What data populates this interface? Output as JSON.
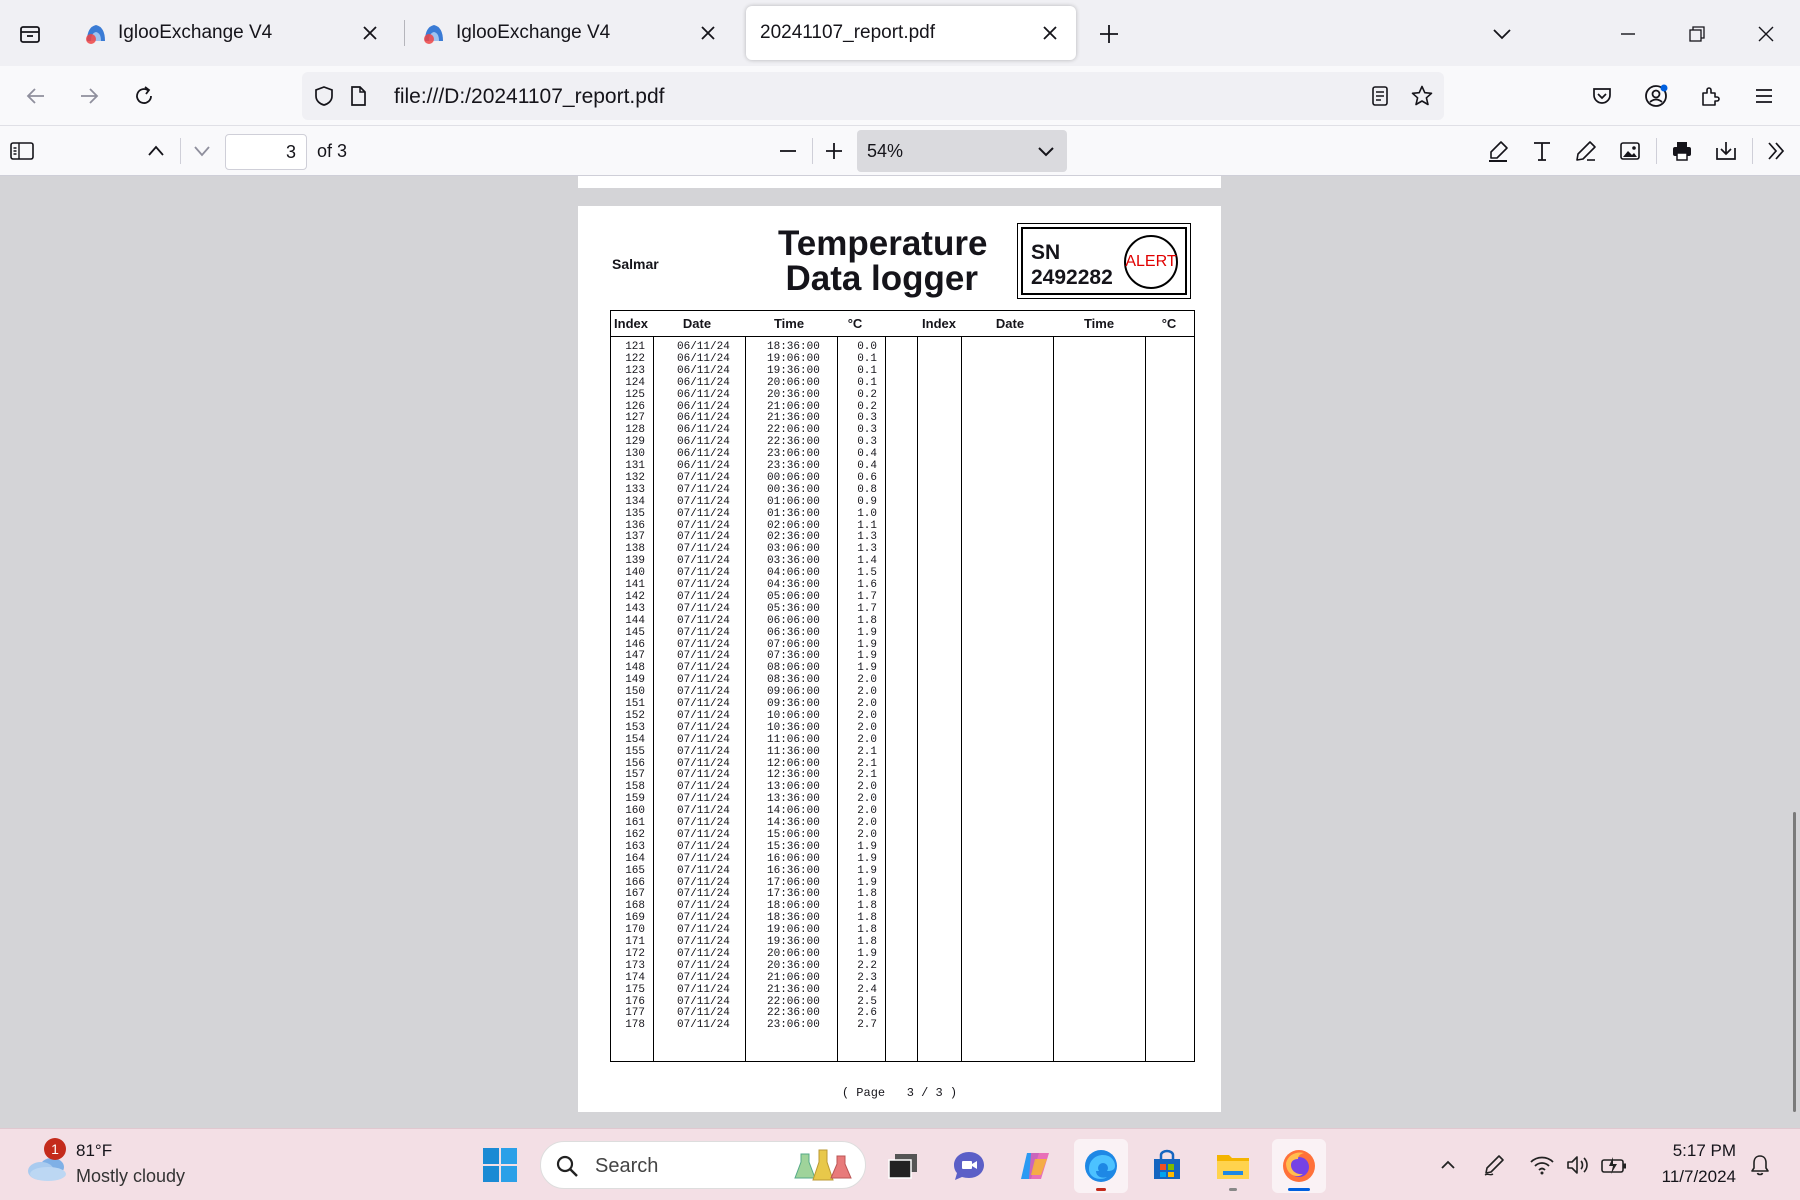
{
  "tabs": [
    {
      "title": "IglooExchange V4",
      "active": false
    },
    {
      "title": "IglooExchange V4",
      "active": false
    },
    {
      "title": "20241107_report.pdf",
      "active": true
    }
  ],
  "urlbar": {
    "url": "file:///D:/20241107_report.pdf"
  },
  "pdf_toolbar": {
    "page_number": "3",
    "page_total": "of 3",
    "zoom": "54%"
  },
  "document": {
    "company": "Salmar",
    "title_line1": "Temperature",
    "title_line2": "Data logger",
    "sn_label": "SN",
    "sn_number": "2492282",
    "alert": "ALERT",
    "columns": [
      "Index",
      "Date",
      "Time",
      "°C",
      "Index",
      "Date",
      "Time",
      "°C"
    ],
    "footer": "( Page   3 / 3 )",
    "rows": [
      [
        "121",
        "06/11/24",
        "18:36:00",
        "0.0"
      ],
      [
        "122",
        "06/11/24",
        "19:06:00",
        "0.1"
      ],
      [
        "123",
        "06/11/24",
        "19:36:00",
        "0.1"
      ],
      [
        "124",
        "06/11/24",
        "20:06:00",
        "0.1"
      ],
      [
        "125",
        "06/11/24",
        "20:36:00",
        "0.2"
      ],
      [
        "126",
        "06/11/24",
        "21:06:00",
        "0.2"
      ],
      [
        "127",
        "06/11/24",
        "21:36:00",
        "0.3"
      ],
      [
        "128",
        "06/11/24",
        "22:06:00",
        "0.3"
      ],
      [
        "129",
        "06/11/24",
        "22:36:00",
        "0.3"
      ],
      [
        "130",
        "06/11/24",
        "23:06:00",
        "0.4"
      ],
      [
        "131",
        "06/11/24",
        "23:36:00",
        "0.4"
      ],
      [
        "132",
        "07/11/24",
        "00:06:00",
        "0.6"
      ],
      [
        "133",
        "07/11/24",
        "00:36:00",
        "0.8"
      ],
      [
        "134",
        "07/11/24",
        "01:06:00",
        "0.9"
      ],
      [
        "135",
        "07/11/24",
        "01:36:00",
        "1.0"
      ],
      [
        "136",
        "07/11/24",
        "02:06:00",
        "1.1"
      ],
      [
        "137",
        "07/11/24",
        "02:36:00",
        "1.3"
      ],
      [
        "138",
        "07/11/24",
        "03:06:00",
        "1.3"
      ],
      [
        "139",
        "07/11/24",
        "03:36:00",
        "1.4"
      ],
      [
        "140",
        "07/11/24",
        "04:06:00",
        "1.5"
      ],
      [
        "141",
        "07/11/24",
        "04:36:00",
        "1.6"
      ],
      [
        "142",
        "07/11/24",
        "05:06:00",
        "1.7"
      ],
      [
        "143",
        "07/11/24",
        "05:36:00",
        "1.7"
      ],
      [
        "144",
        "07/11/24",
        "06:06:00",
        "1.8"
      ],
      [
        "145",
        "07/11/24",
        "06:36:00",
        "1.9"
      ],
      [
        "146",
        "07/11/24",
        "07:06:00",
        "1.9"
      ],
      [
        "147",
        "07/11/24",
        "07:36:00",
        "1.9"
      ],
      [
        "148",
        "07/11/24",
        "08:06:00",
        "1.9"
      ],
      [
        "149",
        "07/11/24",
        "08:36:00",
        "2.0"
      ],
      [
        "150",
        "07/11/24",
        "09:06:00",
        "2.0"
      ],
      [
        "151",
        "07/11/24",
        "09:36:00",
        "2.0"
      ],
      [
        "152",
        "07/11/24",
        "10:06:00",
        "2.0"
      ],
      [
        "153",
        "07/11/24",
        "10:36:00",
        "2.0"
      ],
      [
        "154",
        "07/11/24",
        "11:06:00",
        "2.0"
      ],
      [
        "155",
        "07/11/24",
        "11:36:00",
        "2.1"
      ],
      [
        "156",
        "07/11/24",
        "12:06:00",
        "2.1"
      ],
      [
        "157",
        "07/11/24",
        "12:36:00",
        "2.1"
      ],
      [
        "158",
        "07/11/24",
        "13:06:00",
        "2.0"
      ],
      [
        "159",
        "07/11/24",
        "13:36:00",
        "2.0"
      ],
      [
        "160",
        "07/11/24",
        "14:06:00",
        "2.0"
      ],
      [
        "161",
        "07/11/24",
        "14:36:00",
        "2.0"
      ],
      [
        "162",
        "07/11/24",
        "15:06:00",
        "2.0"
      ],
      [
        "163",
        "07/11/24",
        "15:36:00",
        "1.9"
      ],
      [
        "164",
        "07/11/24",
        "16:06:00",
        "1.9"
      ],
      [
        "165",
        "07/11/24",
        "16:36:00",
        "1.9"
      ],
      [
        "166",
        "07/11/24",
        "17:06:00",
        "1.9"
      ],
      [
        "167",
        "07/11/24",
        "17:36:00",
        "1.8"
      ],
      [
        "168",
        "07/11/24",
        "18:06:00",
        "1.8"
      ],
      [
        "169",
        "07/11/24",
        "18:36:00",
        "1.8"
      ],
      [
        "170",
        "07/11/24",
        "19:06:00",
        "1.8"
      ],
      [
        "171",
        "07/11/24",
        "19:36:00",
        "1.8"
      ],
      [
        "172",
        "07/11/24",
        "20:06:00",
        "1.9"
      ],
      [
        "173",
        "07/11/24",
        "20:36:00",
        "2.2"
      ],
      [
        "174",
        "07/11/24",
        "21:06:00",
        "2.3"
      ],
      [
        "175",
        "07/11/24",
        "21:36:00",
        "2.4"
      ],
      [
        "176",
        "07/11/24",
        "22:06:00",
        "2.5"
      ],
      [
        "177",
        "07/11/24",
        "22:36:00",
        "2.6"
      ],
      [
        "178",
        "07/11/24",
        "23:06:00",
        "2.7"
      ]
    ]
  },
  "taskbar": {
    "weather_badge": "1",
    "weather_temp": "81°F",
    "weather_desc": "Mostly cloudy",
    "search_text": "Search",
    "time": "5:17 PM",
    "date": "11/7/2024"
  },
  "icons": {
    "tab_list": "tab-list-icon",
    "favicon": "igloo-favicon-icon",
    "close": "close-icon",
    "new_tab": "plus-icon",
    "back": "back-arrow-icon",
    "forward": "forward-arrow-icon",
    "reload": "reload-icon",
    "shield": "shield-icon",
    "page": "page-icon",
    "reader": "reader-view-icon",
    "star": "star-icon",
    "pocket": "pocket-icon",
    "account": "account-icon",
    "extensions": "extensions-icon",
    "menu": "hamburger-menu-icon"
  },
  "colors": {
    "alert": "#e00000",
    "accent": "#0060df",
    "badge": "#c42b1c"
  }
}
